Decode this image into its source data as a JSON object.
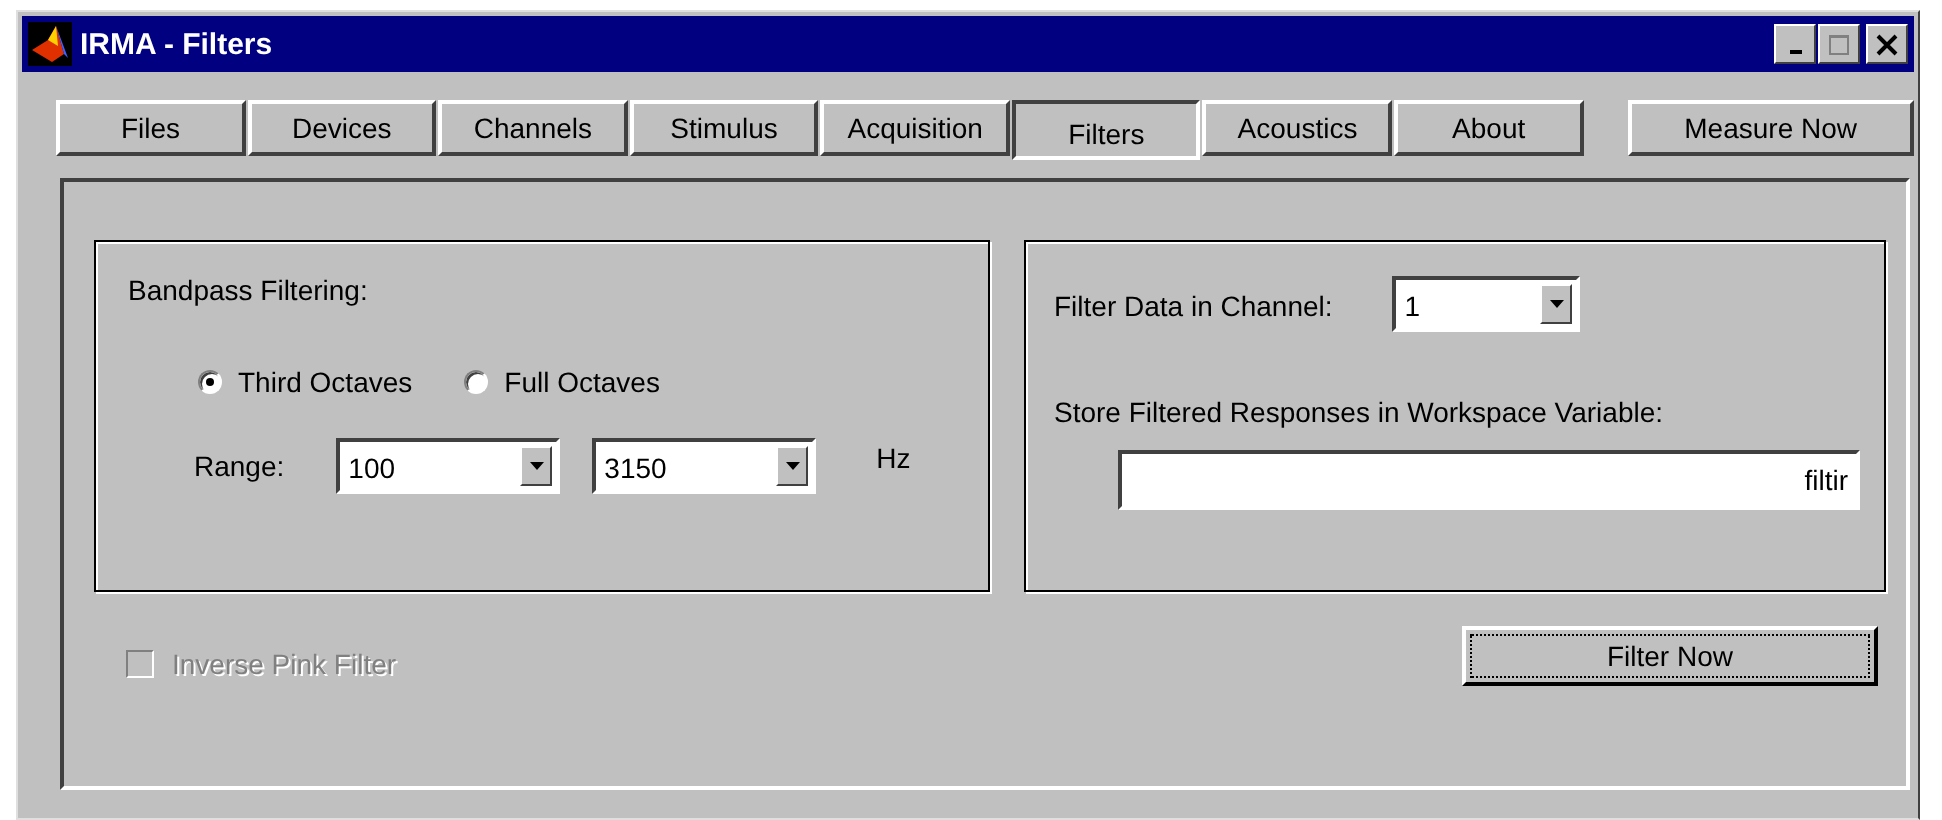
{
  "window": {
    "title": "IRMA - Filters"
  },
  "tabs": [
    {
      "label": "Files",
      "selected": false
    },
    {
      "label": "Devices",
      "selected": false
    },
    {
      "label": "Channels",
      "selected": false
    },
    {
      "label": "Stimulus",
      "selected": false
    },
    {
      "label": "Acquisition",
      "selected": false
    },
    {
      "label": "Filters",
      "selected": true
    },
    {
      "label": "Acoustics",
      "selected": false
    },
    {
      "label": "About",
      "selected": false
    }
  ],
  "measure_button": "Measure Now",
  "bandpass": {
    "label": "Bandpass Filtering:",
    "options": [
      {
        "label": "Third Octaves",
        "selected": true
      },
      {
        "label": "Full Octaves",
        "selected": false
      }
    ],
    "range_label": "Range:",
    "range_low": "100",
    "range_high": "3150",
    "unit": "Hz"
  },
  "channel": {
    "label": "Filter Data in Channel:",
    "value": "1"
  },
  "store": {
    "label": "Store Filtered Responses in Workspace Variable:",
    "value": "filtir"
  },
  "inverse_pink": {
    "label": "Inverse Pink Filter",
    "checked": false,
    "disabled": true
  },
  "filter_button": "Filter Now"
}
